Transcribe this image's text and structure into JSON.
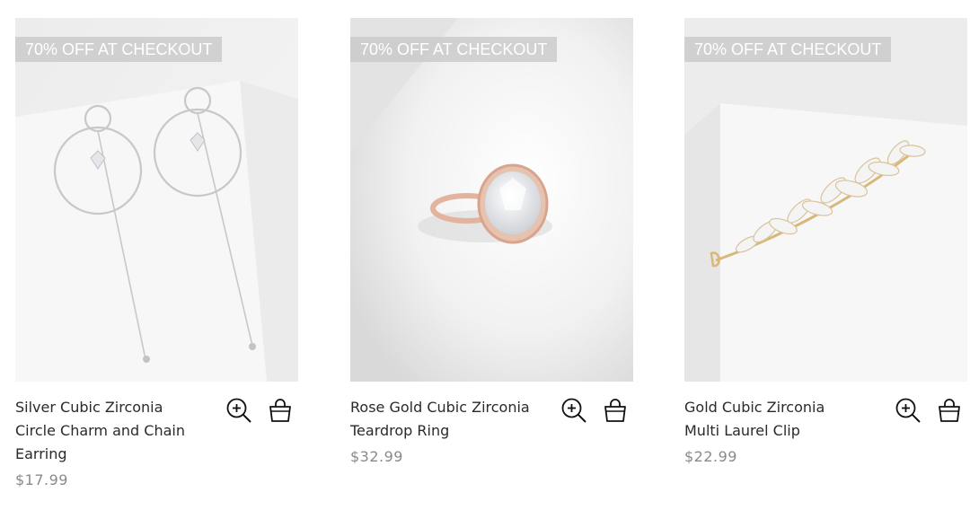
{
  "products": [
    {
      "badge": "70% OFF AT CHECKOUT",
      "name": "Silver Cubic Zirconia Circle Charm and Chain Earring",
      "price": "$17.99",
      "image_icon": "earring-photo"
    },
    {
      "badge": "70% OFF AT CHECKOUT",
      "name": "Rose Gold Cubic Zirconia Teardrop Ring",
      "price": "$32.99",
      "image_icon": "ring-photo"
    },
    {
      "badge": "70% OFF AT CHECKOUT",
      "name": "Gold Cubic Zirconia Multi Laurel Clip",
      "price": "$22.99",
      "image_icon": "hair-clip-photo"
    }
  ],
  "icons": {
    "quick_view": "zoom-in-icon",
    "add_to_bag": "shopping-bag-icon"
  },
  "colors": {
    "badge_bg": "#c8c8c8",
    "badge_text": "#ffffff",
    "price": "#8a8a8a",
    "name": "#2a2a2a"
  }
}
